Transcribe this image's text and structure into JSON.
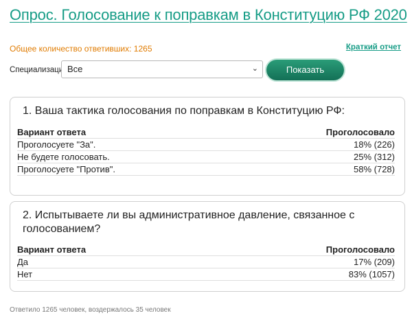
{
  "header": {
    "title": "Опрос. Голосование к поправкам в Конституцию РФ 2020",
    "respondents": "Общее количество ответивших: 1265",
    "short_report": "Краткий отчет"
  },
  "filter": {
    "label": "Специализация",
    "selected": "Все",
    "button": "Показать"
  },
  "questions": [
    {
      "text": "1. Ваша тактика голосования по поправкам в Конституцию РФ:",
      "col_answer": "Вариант ответа",
      "col_votes": "Проголосовало",
      "rows": [
        {
          "answer": "Проголосуете \"За\".",
          "votes": "18% (226)"
        },
        {
          "answer": "Не будете голосовать.",
          "votes": "25% (312)"
        },
        {
          "answer": "Проголосуете \"Против\".",
          "votes": "58% (728)"
        }
      ]
    },
    {
      "text": "2. Испытываете ли вы административное давление, связанное с голосованием?",
      "col_answer": "Вариант ответа",
      "col_votes": "Проголосовало",
      "rows": [
        {
          "answer": "Да",
          "votes": "17% (209)"
        },
        {
          "answer": "Нет",
          "votes": "83% (1057)"
        }
      ]
    }
  ],
  "footer": "Ответило 1265 человек, воздержалось 35 человек"
}
